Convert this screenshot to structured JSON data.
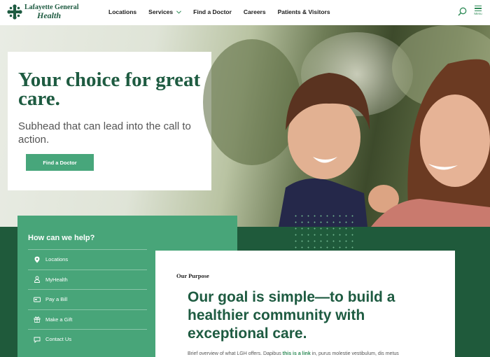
{
  "brand": {
    "name_line1": "Lafayette General",
    "name_line2": "Health",
    "color": "#1e5b41",
    "accent": "#47a67b"
  },
  "nav": {
    "items": [
      {
        "label": "Locations"
      },
      {
        "label": "Services",
        "has_dropdown": true
      },
      {
        "label": "Find a Doctor"
      },
      {
        "label": "Careers"
      },
      {
        "label": "Patients & Visitors"
      }
    ],
    "search_icon": "search-icon",
    "menu_label": "Menu"
  },
  "hero": {
    "title": "Your choice for great care.",
    "subhead": "Subhead that can lead into the call to action.",
    "cta_label": "Find a Doctor"
  },
  "help": {
    "title": "How can we help?",
    "items": [
      {
        "label": "Locations",
        "icon": "map-pin-icon"
      },
      {
        "label": "MyHealth",
        "icon": "person-icon"
      },
      {
        "label": "Pay a Bill",
        "icon": "credit-card-icon"
      },
      {
        "label": "Make a Gift",
        "icon": "gift-icon"
      },
      {
        "label": "Contact Us",
        "icon": "chat-icon"
      }
    ]
  },
  "purpose": {
    "label": "Our Purpose",
    "heading": "Our goal is simple—to build a healthier community with exceptional care.",
    "body_before": "Brief overview of what LGH offers. Dapibus ",
    "body_link": "this is a link",
    "body_after": " in, purus molestie vestibulum, dis metus"
  }
}
